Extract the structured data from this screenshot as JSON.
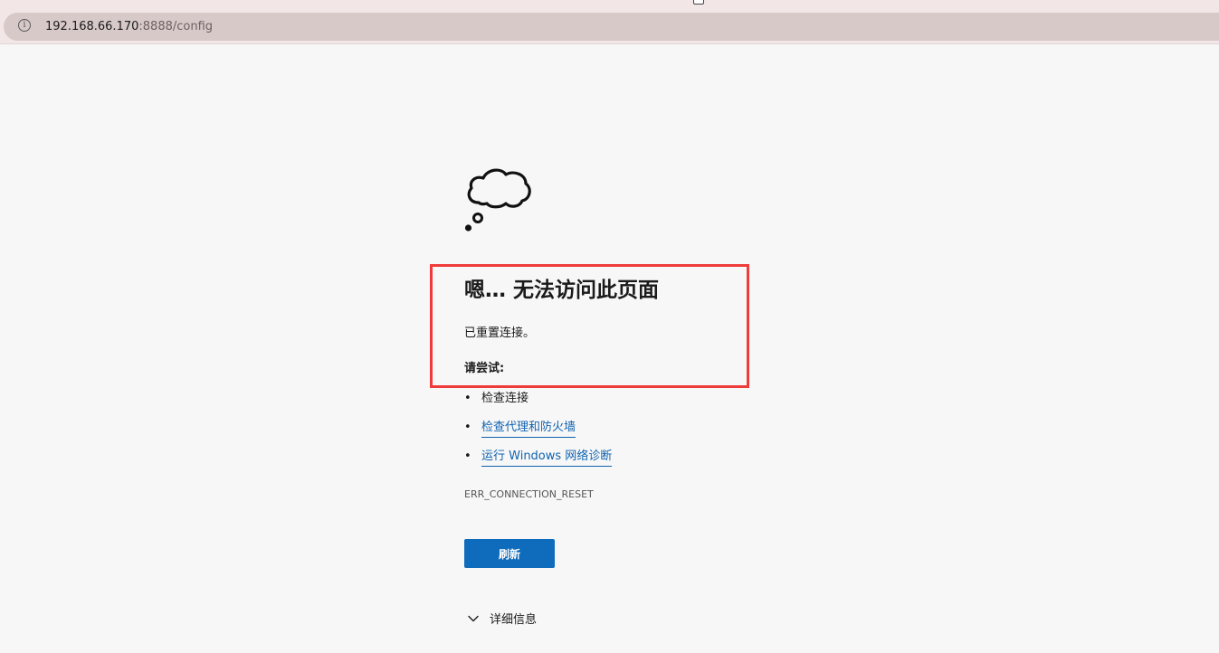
{
  "browser": {
    "address_host": "192.168.66.170",
    "address_path": ":8888/config",
    "info_icon": "info-icon"
  },
  "error_page": {
    "icon": "thought-cloud-icon",
    "title": "嗯… 无法访问此页面",
    "subtitle": "已重置连接。",
    "try_heading": "请尝试:",
    "suggestions": [
      {
        "label": "检查连接",
        "is_link": false
      },
      {
        "label": "检查代理和防火墙",
        "is_link": true
      },
      {
        "label": "运行 Windows 网络诊断",
        "is_link": true
      }
    ],
    "error_code": "ERR_CONNECTION_RESET",
    "refresh_label": "刷新",
    "details_label": "详细信息"
  },
  "colors": {
    "accent_button": "#0f6cbd",
    "link": "#0f63b0",
    "highlight_border": "#f03b3b",
    "page_background": "#f7f7f7",
    "top_strip": "#f2e6e6",
    "address_bar": "#d8c9c9"
  }
}
